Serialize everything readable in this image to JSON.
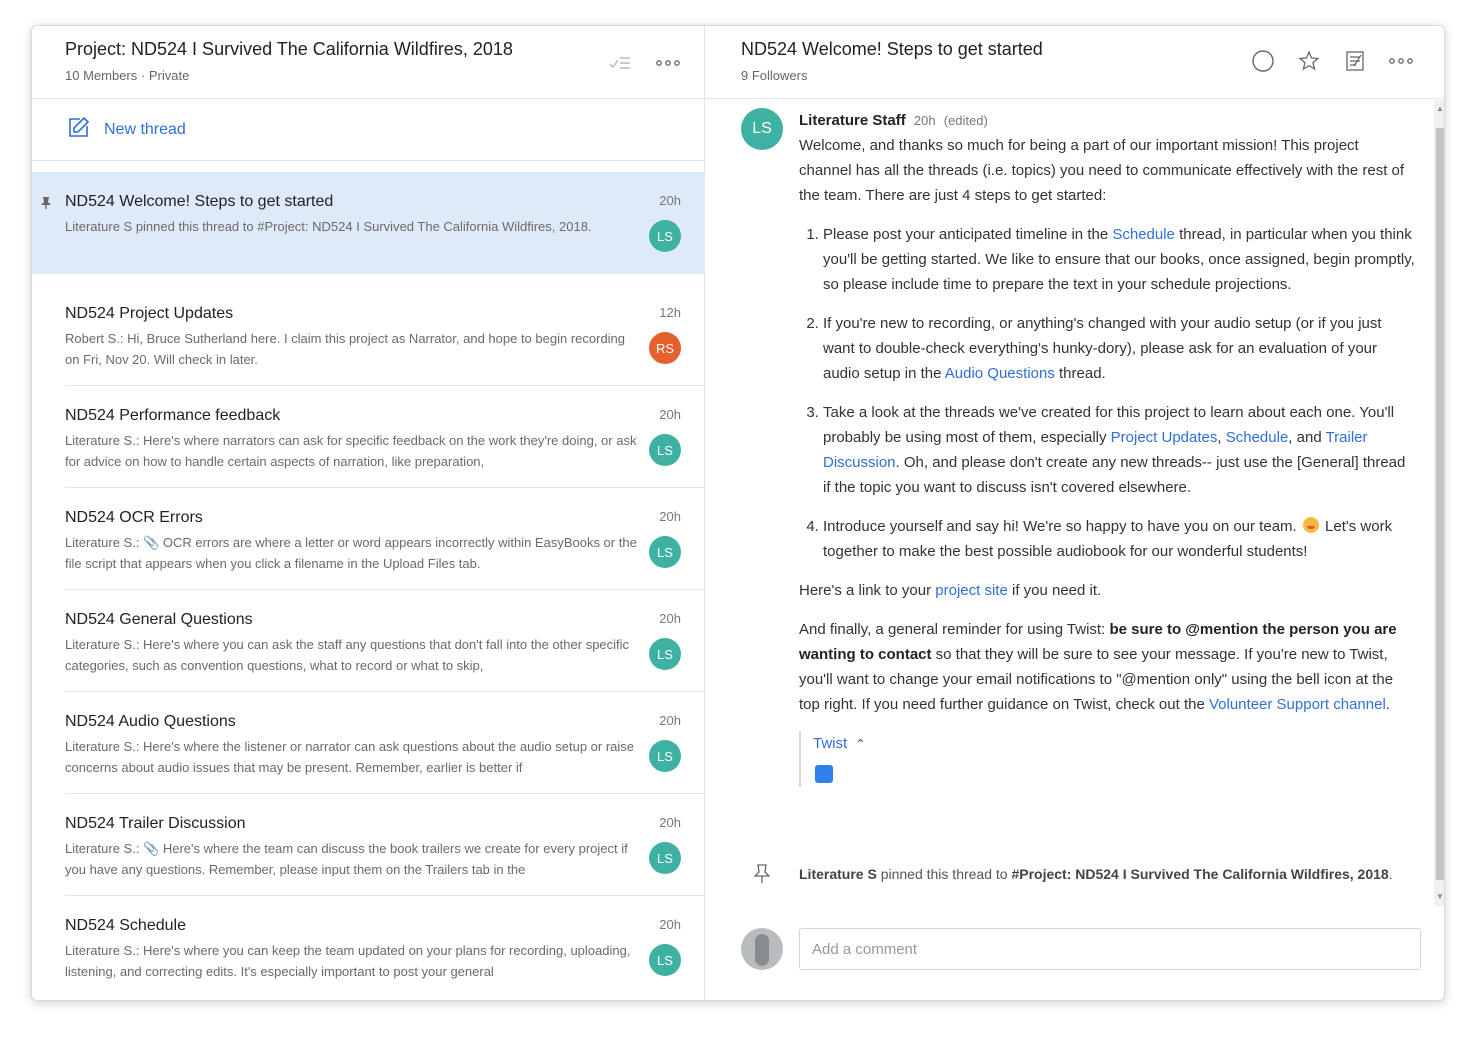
{
  "project": {
    "title": "Project: ND524 I Survived The California Wildfires, 2018",
    "members": "10 Members",
    "separator": "·",
    "privacy": "Private"
  },
  "new_thread_label": "New thread",
  "threads": [
    {
      "title": "ND524 Welcome! Steps to get started",
      "time": "20h",
      "preview": "Literature S pinned this thread to #Project: ND524 I Survived The California Wildfires, 2018.",
      "avatar": "LS",
      "avatar_color": "#3fb1a3",
      "pinned": true
    },
    {
      "title": "ND524 Project Updates",
      "time": "12h",
      "preview": "Robert S.: Hi, Bruce Sutherland here. I claim this project as Narrator, and hope to begin recording on Fri, Nov 20. Will check in later.",
      "avatar": "RS",
      "avatar_color": "#e4612f"
    },
    {
      "title": "ND524 Performance feedback",
      "time": "20h",
      "preview": "Literature S.: Here's where narrators can ask for specific feedback on the work they're doing, or ask for advice on how to handle certain aspects of narration, like preparation,",
      "avatar": "LS",
      "avatar_color": "#3fb1a3"
    },
    {
      "title": "ND524 OCR Errors",
      "time": "20h",
      "preview": "Literature S.: 📎 OCR errors are where a letter or word appears incorrectly within EasyBooks or the file script that appears when you click a filename in the Upload Files tab.",
      "avatar": "LS",
      "avatar_color": "#3fb1a3"
    },
    {
      "title": "ND524 General Questions",
      "time": "20h",
      "preview": "Literature S.: Here's where you can ask the staff any questions that don't fall into the other specific categories, such as convention questions, what to record or what to skip,",
      "avatar": "LS",
      "avatar_color": "#3fb1a3"
    },
    {
      "title": "ND524 Audio Questions",
      "time": "20h",
      "preview": "Literature S.: Here's where the listener or narrator can ask questions about the audio setup or raise concerns about audio issues that may be present. Remember, earlier is better if",
      "avatar": "LS",
      "avatar_color": "#3fb1a3"
    },
    {
      "title": "ND524 Trailer Discussion",
      "time": "20h",
      "preview": "Literature S.: 📎 Here's where the team can discuss the book trailers we create for every project if you have any questions. Remember, please input them on the Trailers tab in the",
      "avatar": "LS",
      "avatar_color": "#3fb1a3"
    },
    {
      "title": "ND524 Schedule",
      "time": "20h",
      "preview": "Literature S.: Here's where you can keep the team updated on your plans for recording, uploading, listening, and correcting edits. It's especially important to post your general",
      "avatar": "LS",
      "avatar_color": "#3fb1a3"
    }
  ],
  "thread_view": {
    "title": "ND524 Welcome! Steps to get started",
    "followers": "9 Followers",
    "message": {
      "avatar": "LS",
      "author": "Literature Staff",
      "time": "20h",
      "edited": "(edited)",
      "intro": "Welcome, and thanks so much for being a part of our important mission! This project channel has all the threads (i.e. topics) you need to communicate effectively with the rest of the team. There are just 4 steps to get started:",
      "step1_a": "Please post your anticipated timeline in the ",
      "step1_link": "Schedule",
      "step1_b": " thread, in particular when you think you'll be getting started. We like to ensure that our books, once assigned, begin promptly, so please include time to prepare the text in your schedule projections.",
      "step2_a": "If you're new to recording, or anything's changed with your audio setup (or if you just want to double-check everything's hunky-dory), please ask for an evaluation of your audio setup in the ",
      "step2_link": "Audio Questions",
      "step2_b": " thread.",
      "step3_a": "Take a look at the threads we've created for this project to learn about each one. You'll probably be using most of them, especially ",
      "step3_link1": "Project Updates",
      "step3_comma": ", ",
      "step3_link2": "Schedule",
      "step3_and": ", and ",
      "step3_link3": "Trailer Discussion",
      "step3_b": ". Oh, and please don't create any new threads-- just use the [General] thread if the topic you want to discuss isn't covered elsewhere.",
      "step4_a": "Introduce yourself and say hi! We're so happy to have you on our team. ",
      "step4_b": " Let's work together to make the best possible audiobook for our wonderful students!",
      "link_line_a": "Here's a link to your ",
      "link_line_link": "project site",
      "link_line_b": " if you need it.",
      "final_a": "And finally, a general reminder for using Twist: ",
      "final_bold": "be sure to @mention the person you are wanting to contact",
      "final_b": " so that they will be sure to see your message. If you're new to Twist, you'll want to change your email notifications to \"@mention only\" using the bell icon at the top right. If you need further guidance on Twist, check out the ",
      "final_link": "Volunteer Support channel",
      "final_c": ".",
      "attachment_title": "Twist",
      "attachment_caret": "⌃"
    },
    "pin_event": {
      "who": "Literature S",
      "text": " pinned this thread to ",
      "where": "#Project: ND524 I Survived The California Wildfires, 2018",
      "end": "."
    },
    "comment_placeholder": "Add a comment"
  }
}
